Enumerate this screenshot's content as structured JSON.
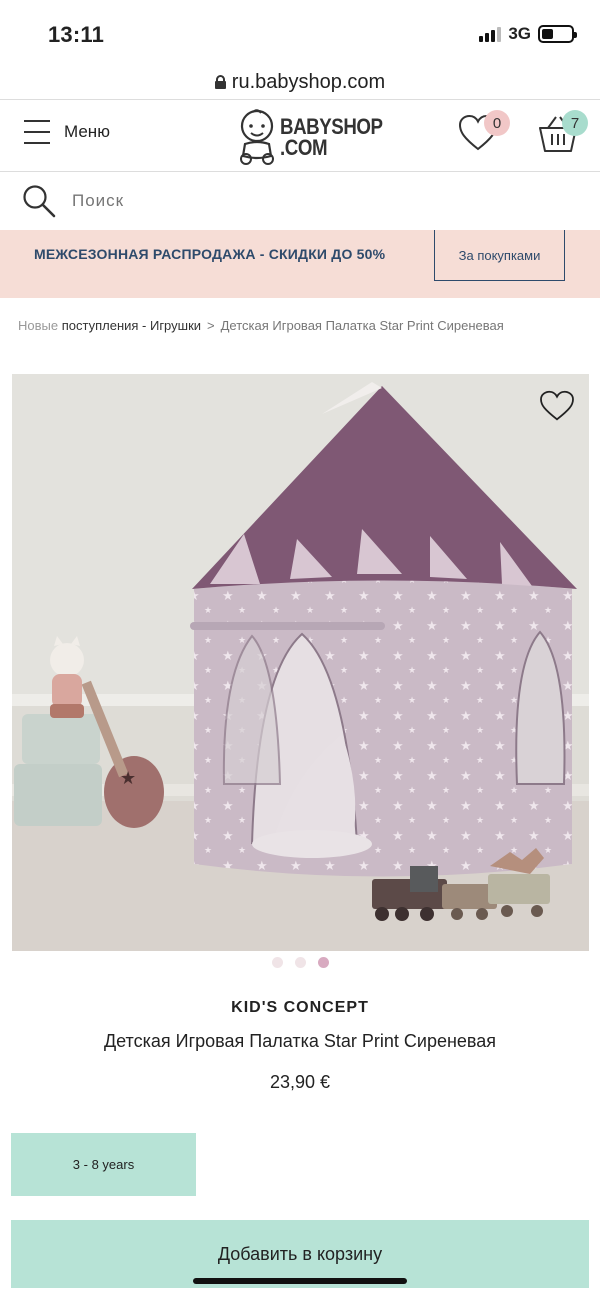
{
  "status_bar": {
    "time": "13:11",
    "network": "3G"
  },
  "url_bar": {
    "url": "ru.babyshop.com"
  },
  "header": {
    "menu_label": "Меню",
    "logo_line1": "BABYSHOP",
    "logo_line2": ".COM",
    "wishlist_count": "0",
    "cart_count": "7",
    "colors": {
      "wishlist_badge": "#f1c7c7",
      "cart_badge": "#a8dccd"
    }
  },
  "search": {
    "placeholder": "Поиск"
  },
  "promo": {
    "text": "МЕЖСЕЗОННАЯ РАСПРОДАЖА - СКИДКИ ДО 50%",
    "button_label": "За покупками",
    "colors": {
      "background": "#f6ddd6",
      "text": "#2e4a6b"
    }
  },
  "breadcrumb": {
    "part1_muted": "Новые ",
    "part1_rest": "поступления - Игрушки",
    "separator": ">",
    "current": "Детская Игровая Палатка Star Print Сиреневая"
  },
  "gallery": {
    "active_slide": 3,
    "slide_count": 3
  },
  "product": {
    "brand": "KID'S CONCEPT",
    "title": "Детская Игровая Палатка Star Print Сиреневая",
    "price": "23,90 €",
    "size_option": "3 - 8 years",
    "add_to_cart_label": "Добавить в корзину",
    "button_color": "#b7e3d6"
  }
}
